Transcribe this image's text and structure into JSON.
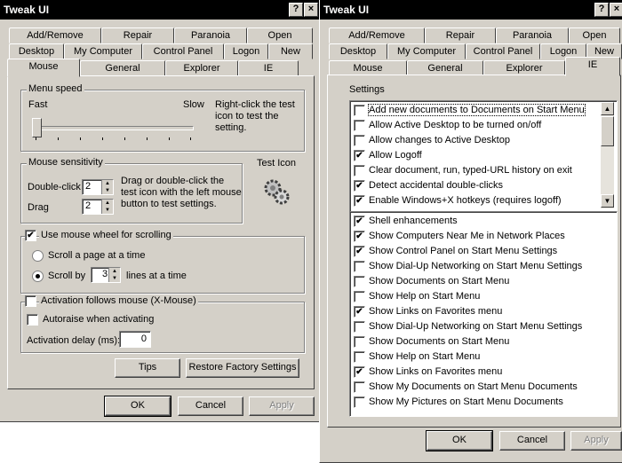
{
  "left": {
    "title": "Tweak UI",
    "title_buttons": {
      "help": "?",
      "close": "×"
    },
    "tabs_row1": [
      "Add/Remove",
      "Repair",
      "Paranoia",
      "Open"
    ],
    "tabs_row2": [
      "Desktop",
      "My Computer",
      "Control Panel",
      "Logon",
      "New"
    ],
    "tabs_row3": [
      "Mouse",
      "General",
      "Explorer",
      "IE"
    ],
    "active_tab": "Mouse",
    "menu_speed": {
      "label": "Menu speed",
      "fast": "Fast",
      "slow": "Slow",
      "hint": "Right-click the test icon to test the setting.",
      "level": 0.0
    },
    "mouse_sensitivity": {
      "label": "Mouse sensitivity",
      "doubleclick_label": "Double-click",
      "doubleclick_value": "2",
      "drag_label": "Drag",
      "drag_value": "2",
      "hint": "Drag or double-click the test icon with the left mouse button to test settings."
    },
    "test_icon": {
      "label": "Test Icon",
      "icon": "gears-icon"
    },
    "wheel": {
      "use_wheel_label": "Use mouse wheel for scrolling",
      "use_wheel_checked": true,
      "scroll_page_label": "Scroll a page at a time",
      "scroll_by_label": "Scroll by",
      "scroll_by_value": "3",
      "lines_label": "lines at a time"
    },
    "activation": {
      "follows_label": "Activation follows mouse (X-Mouse)",
      "autoraise_label": "Autoraise when activating",
      "delay_label": "Activation delay (ms):",
      "delay_value": "0"
    },
    "buttons": {
      "tips": "Tips",
      "restore": "Restore Factory Settings",
      "ok": "OK",
      "cancel": "Cancel",
      "apply": "Apply"
    }
  },
  "right": {
    "title": "Tweak UI",
    "title_buttons": {
      "help": "?",
      "close": "×"
    },
    "tabs_row1": [
      "Add/Remove",
      "Repair",
      "Paranoia",
      "Open"
    ],
    "tabs_row2": [
      "Desktop",
      "My Computer",
      "Control Panel",
      "Logon",
      "New"
    ],
    "tabs_row3": [
      "Mouse",
      "General",
      "Explorer",
      "IE"
    ],
    "active_tab": "IE",
    "settings_label": "Settings",
    "settings_top": [
      {
        "label": "Add new documents to Documents on Start Menu",
        "checked": false
      },
      {
        "label": "Allow Active Desktop to be turned on/off",
        "checked": false
      },
      {
        "label": "Allow changes to Active Desktop",
        "checked": false
      },
      {
        "label": "Allow Logoff",
        "checked": true
      },
      {
        "label": "Clear document, run, typed-URL history on exit",
        "checked": false
      },
      {
        "label": "Detect accidental double-clicks",
        "checked": true
      },
      {
        "label": "Enable Windows+X hotkeys (requires logoff)",
        "checked": true
      }
    ],
    "settings_bottom": [
      {
        "label": "Shell enhancements",
        "checked": true
      },
      {
        "label": "Show Computers Near Me in Network Places",
        "checked": true
      },
      {
        "label": "Show Control Panel on Start Menu Settings",
        "checked": true
      },
      {
        "label": "Show Dial-Up Networking on Start Menu Settings",
        "checked": false
      },
      {
        "label": "Show Documents on Start Menu",
        "checked": false
      },
      {
        "label": "Show Help on Start Menu",
        "checked": false
      },
      {
        "label": "Show Links on Favorites menu",
        "checked": true
      },
      {
        "label": "Show Dial-Up Networking on Start Menu Settings",
        "checked": false
      },
      {
        "label": "Show Documents on Start Menu",
        "checked": false
      },
      {
        "label": "Show Help on Start Menu",
        "checked": false
      },
      {
        "label": "Show Links on Favorites menu",
        "checked": true
      },
      {
        "label": "Show My Documents on Start Menu Documents",
        "checked": false
      },
      {
        "label": "Show My Pictures on Start Menu Documents",
        "checked": false
      }
    ],
    "buttons": {
      "ok": "OK",
      "cancel": "Cancel",
      "apply": "Apply"
    }
  }
}
